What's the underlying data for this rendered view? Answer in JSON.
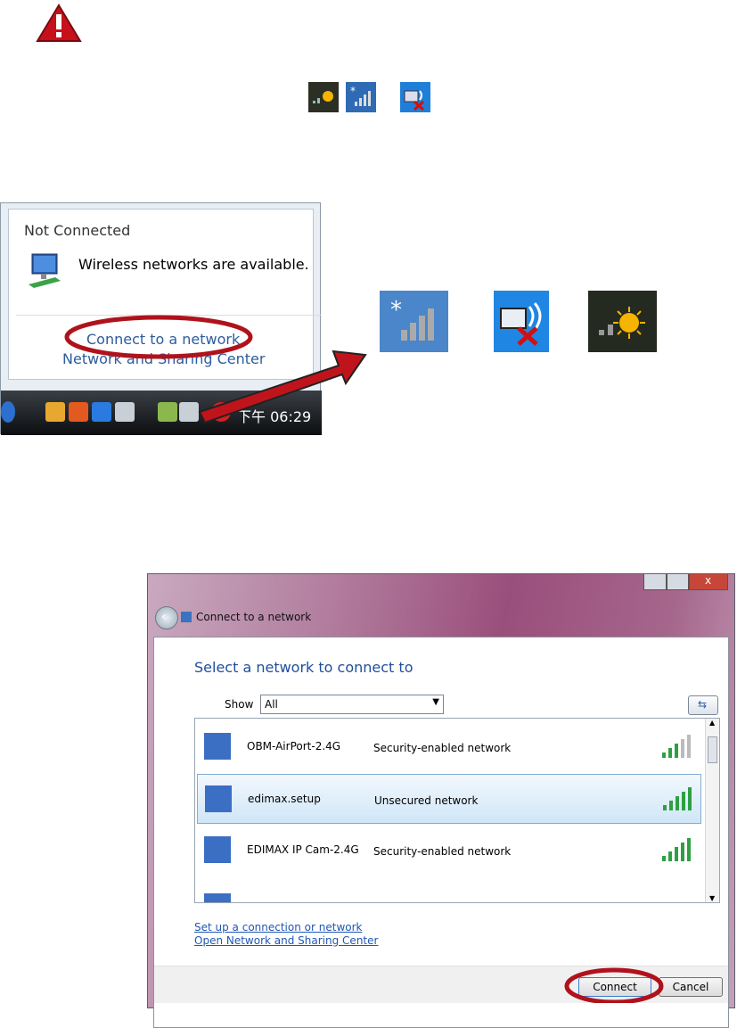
{
  "popup": {
    "status": "Not Connected",
    "message": "Wireless networks are available.",
    "link_connect": "Connect to a network",
    "link_center": "Network and Sharing Center"
  },
  "taskbar": {
    "time": "下午 06:29"
  },
  "dialog": {
    "title": "Connect to a network",
    "heading": "Select a network to connect to",
    "show_label": "Show",
    "show_value": "All",
    "networks": [
      {
        "name": "OBM-AirPort-2.4G",
        "security": "Security-enabled network",
        "signal": 3
      },
      {
        "name": "edimax.setup",
        "security": "Unsecured network",
        "signal": 5
      },
      {
        "name": "EDIMAX IP Cam-2.4G",
        "security": "Security-enabled network",
        "signal": 5
      }
    ],
    "link_setup": "Set up a connection or network",
    "link_center": "Open Network and Sharing Center",
    "connect_label": "Connect",
    "cancel_label": "Cancel"
  },
  "colors": {
    "highlight_oval": "#b0121b",
    "arrow": "#c0141c",
    "link": "#1f57b5"
  }
}
